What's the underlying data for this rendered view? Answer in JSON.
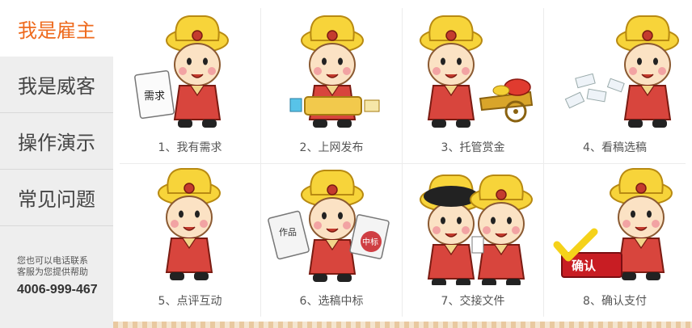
{
  "tabs": [
    {
      "label": "我是雇主",
      "active": true
    },
    {
      "label": "我是威客",
      "active": false
    },
    {
      "label": "操作演示",
      "active": false
    },
    {
      "label": "常见问题",
      "active": false
    }
  ],
  "contact": {
    "line1": "您也可以电话联系",
    "line2": "客服为您提供帮助",
    "phone": "4006-999-467"
  },
  "steps": [
    {
      "caption": "1、我有需求",
      "sign_text": "需求"
    },
    {
      "caption": "2、上网发布"
    },
    {
      "caption": "3、托管赏金"
    },
    {
      "caption": "4、看稿选稿"
    },
    {
      "caption": "5、点评互动"
    },
    {
      "caption": "6、选稿中标",
      "paper_text": "作品",
      "stamp_text": "中标"
    },
    {
      "caption": "7、交接文件"
    },
    {
      "caption": "8、确认支付",
      "button_text": "确认"
    }
  ],
  "colors": {
    "accent": "#ee6a1d",
    "hat": "#f7d43a",
    "robe": "#d8453d",
    "confirm": "#c81d23"
  }
}
